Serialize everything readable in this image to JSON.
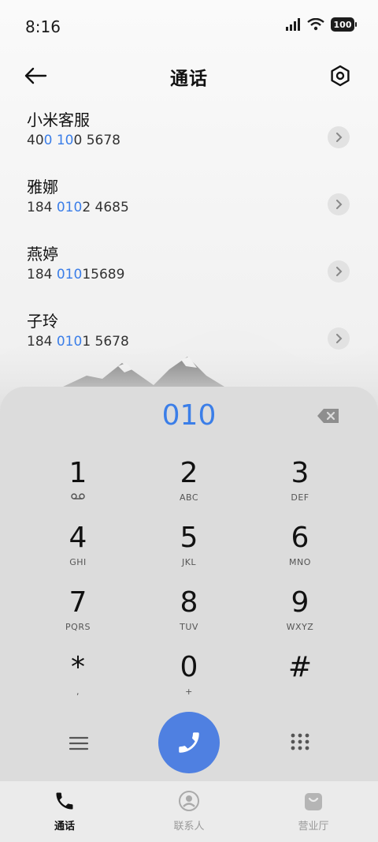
{
  "status_bar": {
    "time": "8:16",
    "battery": "100"
  },
  "header": {
    "title": "通话"
  },
  "contacts": [
    {
      "name": "小米客服",
      "num_parts": [
        "40",
        "0 10",
        "0 5678"
      ]
    },
    {
      "name": "雅娜",
      "num_parts": [
        "184 ",
        "010",
        "2 4685"
      ]
    },
    {
      "name": "燕婷",
      "num_parts": [
        "184 ",
        "010",
        "15689"
      ]
    },
    {
      "name": "子玲",
      "num_parts": [
        "184 ",
        "010",
        "1 5678"
      ]
    }
  ],
  "dialer": {
    "input": "010",
    "keys": [
      {
        "digit": "1",
        "letters": ""
      },
      {
        "digit": "2",
        "letters": "ABC"
      },
      {
        "digit": "3",
        "letters": "DEF"
      },
      {
        "digit": "4",
        "letters": "GHI"
      },
      {
        "digit": "5",
        "letters": "JKL"
      },
      {
        "digit": "6",
        "letters": "MNO"
      },
      {
        "digit": "7",
        "letters": "PQRS"
      },
      {
        "digit": "8",
        "letters": "TUV"
      },
      {
        "digit": "9",
        "letters": "WXYZ"
      },
      {
        "digit": "*",
        "letters": ","
      },
      {
        "digit": "0",
        "letters": "+"
      },
      {
        "digit": "#",
        "letters": ""
      }
    ]
  },
  "bottom_nav": [
    {
      "label": "通话",
      "icon": "phone-icon",
      "active": true
    },
    {
      "label": "联系人",
      "icon": "person-icon",
      "active": false
    },
    {
      "label": "营业厅",
      "icon": "shopping-bag-icon",
      "active": false
    }
  ],
  "colors": {
    "accent": "#3b7ee8",
    "call_button": "#4f80e1",
    "panel": "#dcdcdc"
  }
}
